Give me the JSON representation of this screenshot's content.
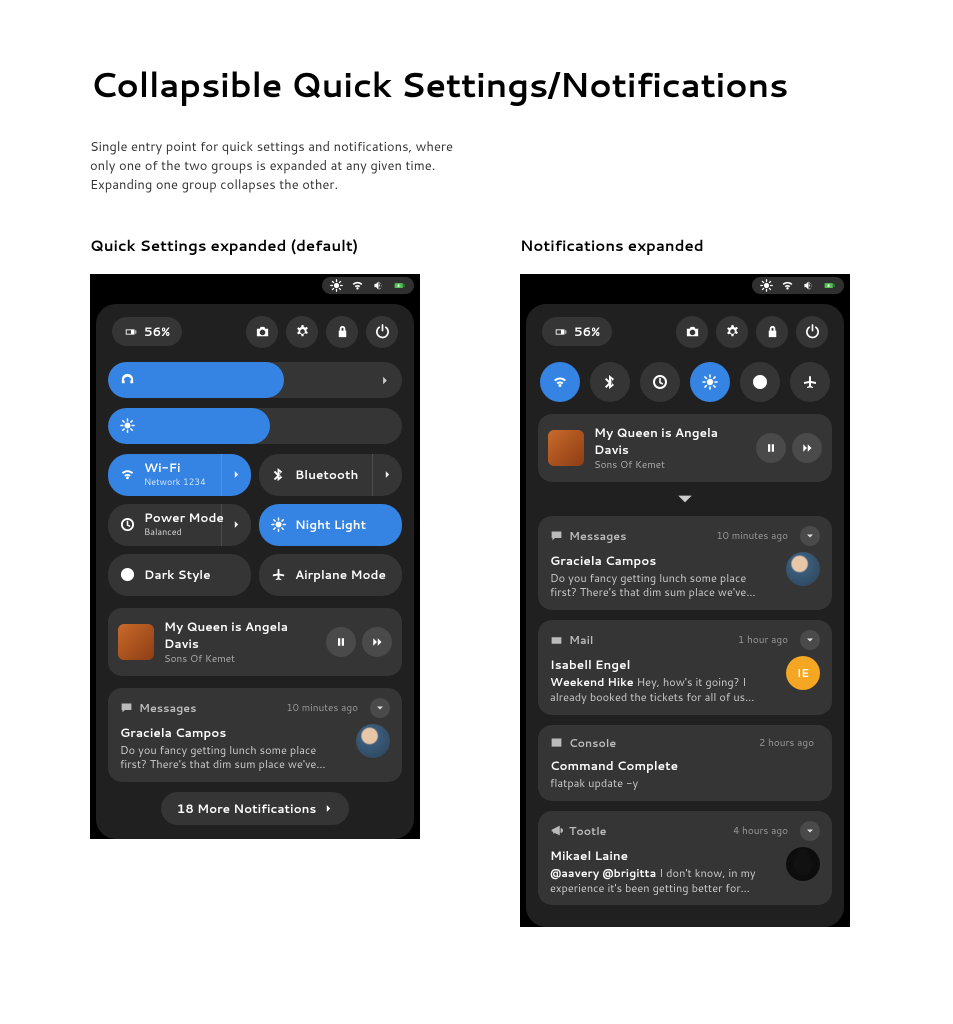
{
  "page": {
    "title": "Collapsible Quick Settings/Notifications",
    "description": "Single entry point for quick settings and notifications, where only one of the two groups is expanded at any given time. Expanding one group collapses the other."
  },
  "columns": {
    "left_title": "Quick Settings expanded (default)",
    "right_title": "Notifications expanded"
  },
  "battery": {
    "label": "56%"
  },
  "sliders": {
    "volume_pct": 60,
    "brightness_pct": 55
  },
  "toggles": {
    "wifi": {
      "label": "Wi-Fi",
      "sub": "Network 1234",
      "active": true,
      "has_chevron": true
    },
    "bluetooth": {
      "label": "Bluetooth",
      "active": false,
      "has_chevron": true
    },
    "power": {
      "label": "Power Mode",
      "sub": "Balanced",
      "active": false,
      "has_chevron": true
    },
    "nightlight": {
      "label": "Night Light",
      "active": true
    },
    "darkstyle": {
      "label": "Dark Style",
      "active": false
    },
    "airplane": {
      "label": "Airplane Mode",
      "active": false
    }
  },
  "compact_active": {
    "wifi": true,
    "nightlight": true
  },
  "media": {
    "title": "My Queen is Angela Davis",
    "artist": "Sons Of Kemet"
  },
  "notifications": [
    {
      "app": "Messages",
      "time": "10 minutes ago",
      "sender": "Graciela Campos",
      "text": "Do you fancy getting lunch some place first? There's that dim sum place we've…",
      "avatar": "photo",
      "collapsible": true
    },
    {
      "app": "Mail",
      "time": "1 hour ago",
      "sender": "Isabell Engel",
      "lead": "Weekend Hike",
      "text": "Hey, how's it going? I already booked the tickets for all of us…",
      "avatar": "orange",
      "avatar_initials": "IE",
      "collapsible": true
    },
    {
      "app": "Console",
      "time": "2 hours ago",
      "sender": "Command Complete",
      "text": "flatpak update -y",
      "collapsible": false
    },
    {
      "app": "Tootle",
      "time": "4 hours ago",
      "sender": "Mikael Laine",
      "lead": "@aavery @brigitta",
      "text": "I don't know, in my experience it's been getting better for…",
      "avatar": "dark",
      "collapsible": true
    }
  ],
  "more_label": "18 More Notifications"
}
